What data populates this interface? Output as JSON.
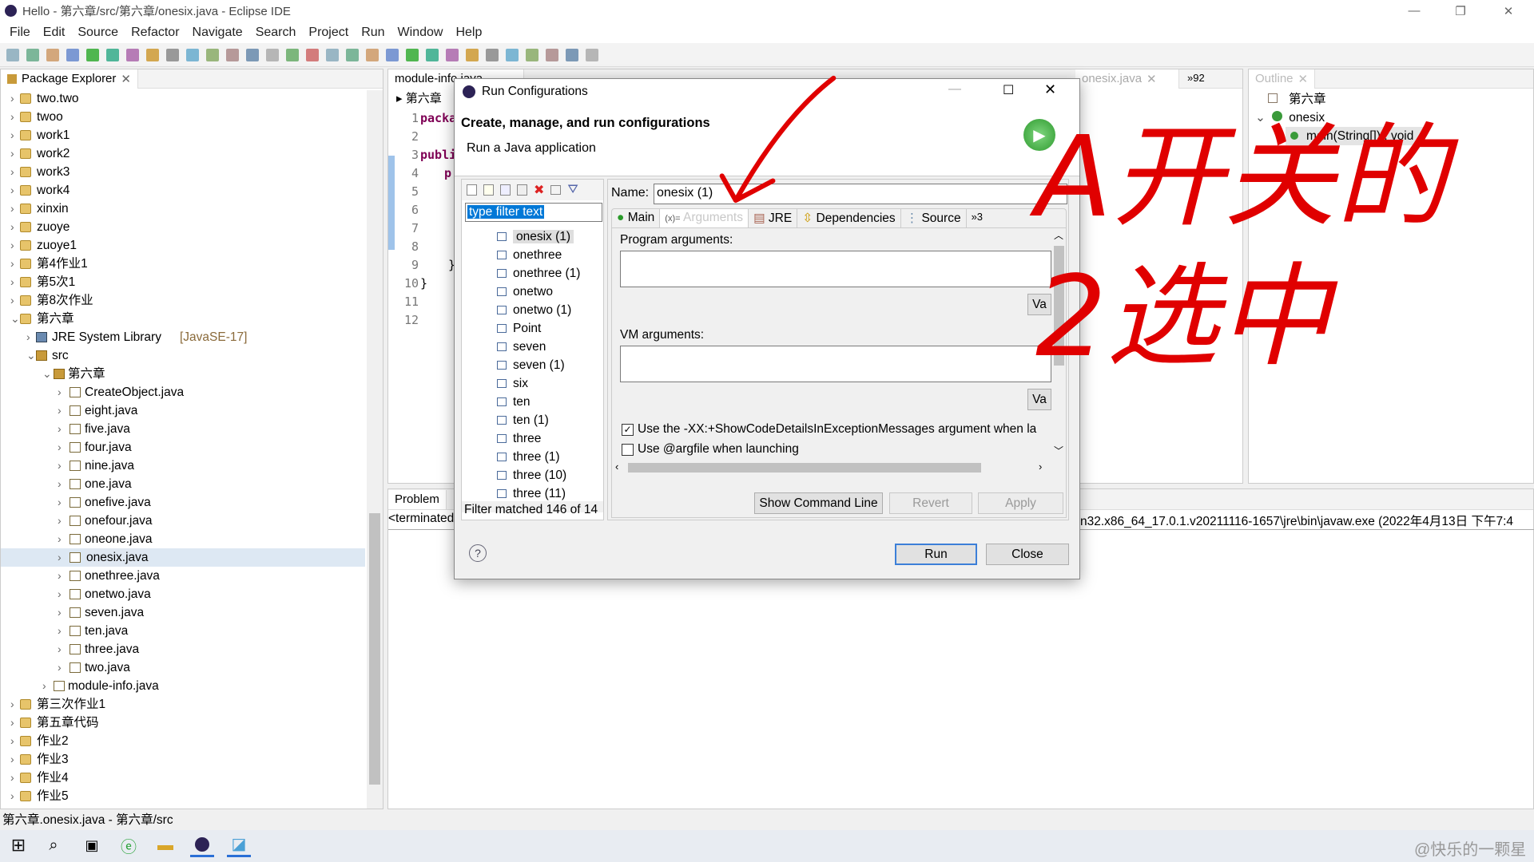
{
  "window": {
    "title": "Hello - 第六章/src/第六章/onesix.java - Eclipse IDE"
  },
  "menu": [
    "File",
    "Edit",
    "Source",
    "Refactor",
    "Navigate",
    "Search",
    "Project",
    "Run",
    "Window",
    "Help"
  ],
  "package_explorer": {
    "title": "Package Explorer",
    "items": [
      {
        "label": "two.two",
        "level": 0,
        "type": "proj",
        "open": false
      },
      {
        "label": "twoo",
        "level": 0,
        "type": "proj",
        "open": false
      },
      {
        "label": "work1",
        "level": 0,
        "type": "proj",
        "open": false
      },
      {
        "label": "work2",
        "level": 0,
        "type": "proj",
        "open": false
      },
      {
        "label": "work3",
        "level": 0,
        "type": "proj",
        "open": false
      },
      {
        "label": "work4",
        "level": 0,
        "type": "proj",
        "open": false
      },
      {
        "label": "xinxin",
        "level": 0,
        "type": "proj",
        "open": false
      },
      {
        "label": "zuoye",
        "level": 0,
        "type": "proj",
        "open": false
      },
      {
        "label": "zuoye1",
        "level": 0,
        "type": "proj",
        "open": false
      },
      {
        "label": "第4作业1",
        "level": 0,
        "type": "proj",
        "open": false
      },
      {
        "label": "第5次1",
        "level": 0,
        "type": "proj",
        "open": false
      },
      {
        "label": "第8次作业",
        "level": 0,
        "type": "proj",
        "open": false
      },
      {
        "label": "第六章",
        "level": 0,
        "type": "proj",
        "open": true
      },
      {
        "label": "JRE System Library",
        "suffix": "[JavaSE-17]",
        "level": 1,
        "type": "lib",
        "open": false
      },
      {
        "label": "src",
        "level": 1,
        "type": "pkg",
        "open": true
      },
      {
        "label": "第六章",
        "level": 2,
        "type": "pkg",
        "open": true
      },
      {
        "label": "CreateObject.java",
        "level": 3,
        "type": "file",
        "open": false
      },
      {
        "label": "eight.java",
        "level": 3,
        "type": "file",
        "open": false
      },
      {
        "label": "five.java",
        "level": 3,
        "type": "file",
        "open": false
      },
      {
        "label": "four.java",
        "level": 3,
        "type": "file",
        "open": false
      },
      {
        "label": "nine.java",
        "level": 3,
        "type": "file",
        "open": false
      },
      {
        "label": "one.java",
        "level": 3,
        "type": "file",
        "open": false
      },
      {
        "label": "onefive.java",
        "level": 3,
        "type": "file",
        "open": false
      },
      {
        "label": "onefour.java",
        "level": 3,
        "type": "file",
        "open": false
      },
      {
        "label": "oneone.java",
        "level": 3,
        "type": "file",
        "open": false
      },
      {
        "label": "onesix.java",
        "level": 3,
        "type": "file",
        "open": false,
        "selected": true
      },
      {
        "label": "onethree.java",
        "level": 3,
        "type": "file",
        "open": false
      },
      {
        "label": "onetwo.java",
        "level": 3,
        "type": "file",
        "open": false
      },
      {
        "label": "seven.java",
        "level": 3,
        "type": "file",
        "open": false
      },
      {
        "label": "ten.java",
        "level": 3,
        "type": "file",
        "open": false
      },
      {
        "label": "three.java",
        "level": 3,
        "type": "file",
        "open": false
      },
      {
        "label": "two.java",
        "level": 3,
        "type": "file",
        "open": false
      },
      {
        "label": "module-info.java",
        "level": 2,
        "type": "file",
        "open": false
      },
      {
        "label": "第三次作业1",
        "level": 0,
        "type": "proj",
        "open": false
      },
      {
        "label": "第五章代码",
        "level": 0,
        "type": "proj",
        "open": false
      },
      {
        "label": "作业2",
        "level": 0,
        "type": "proj",
        "open": false
      },
      {
        "label": "作业3",
        "level": 0,
        "type": "proj",
        "open": false
      },
      {
        "label": "作业4",
        "level": 0,
        "type": "proj",
        "open": false
      },
      {
        "label": "作业5",
        "level": 0,
        "type": "proj",
        "open": false
      }
    ]
  },
  "editor": {
    "tabs": [
      "module-info.java",
      "onesix.java"
    ],
    "overflow": "»92",
    "breadcrumb": "第六章",
    "line_numbers": [
      "1",
      "2",
      "3",
      "4",
      "5",
      "6",
      "7",
      "8",
      "9",
      "10",
      "11",
      "12"
    ],
    "code": [
      "packa",
      "",
      "publi",
      "p",
      "",
      "",
      "",
      "",
      "}",
      "}",
      "",
      ""
    ]
  },
  "outline": {
    "title": "Outline",
    "items": [
      {
        "label": "第六章"
      },
      {
        "label": "onesix"
      },
      {
        "label": "main(String[]) : void"
      }
    ]
  },
  "console": {
    "tab": "Problem",
    "line_left": "<terminated",
    "line_right": "n32.x86_64_17.0.1.v20211116-1657\\jre\\bin\\javaw.exe  (2022年4月13日 下午7:4"
  },
  "status_bar": {
    "text": "第六章.onesix.java - 第六章/src"
  },
  "dialog": {
    "title": "Run Configurations",
    "heading": "Create, manage, and run configurations",
    "subheading": "Run a Java application",
    "filter_placeholder": "type filter text",
    "configs": [
      "onesix (1)",
      "onethree",
      "onethree (1)",
      "onetwo",
      "onetwo (1)",
      "Point",
      "seven",
      "seven (1)",
      "six",
      "ten",
      "ten (1)",
      "three",
      "three (1)",
      "three (10)",
      "three (11)"
    ],
    "selected_config": "onesix (1)",
    "filter_status": "Filter matched 146 of 14",
    "name_label": "Name:",
    "name_value": "onesix (1)",
    "tabs": [
      "Main",
      "Arguments",
      "JRE",
      "Dependencies",
      "Source",
      "»3"
    ],
    "active_tab": "Arguments",
    "program_args_label": "Program arguments:",
    "vm_args_label": "VM arguments:",
    "variables_label": "Va",
    "checkbox1": {
      "label": "Use the -XX:+ShowCodeDetailsInExceptionMessages argument when la",
      "checked": true
    },
    "checkbox2": {
      "label": "Use @argfile when launching",
      "checked": false
    },
    "show_command_line": "Show Command Line",
    "revert": "Revert",
    "apply": "Apply",
    "run": "Run",
    "close": "Close",
    "help": "?"
  },
  "annotation": {
    "text": "A开关的 2选中",
    "color": "#e00000"
  },
  "taskbar": {
    "watermark": "@快乐的一颗星"
  }
}
